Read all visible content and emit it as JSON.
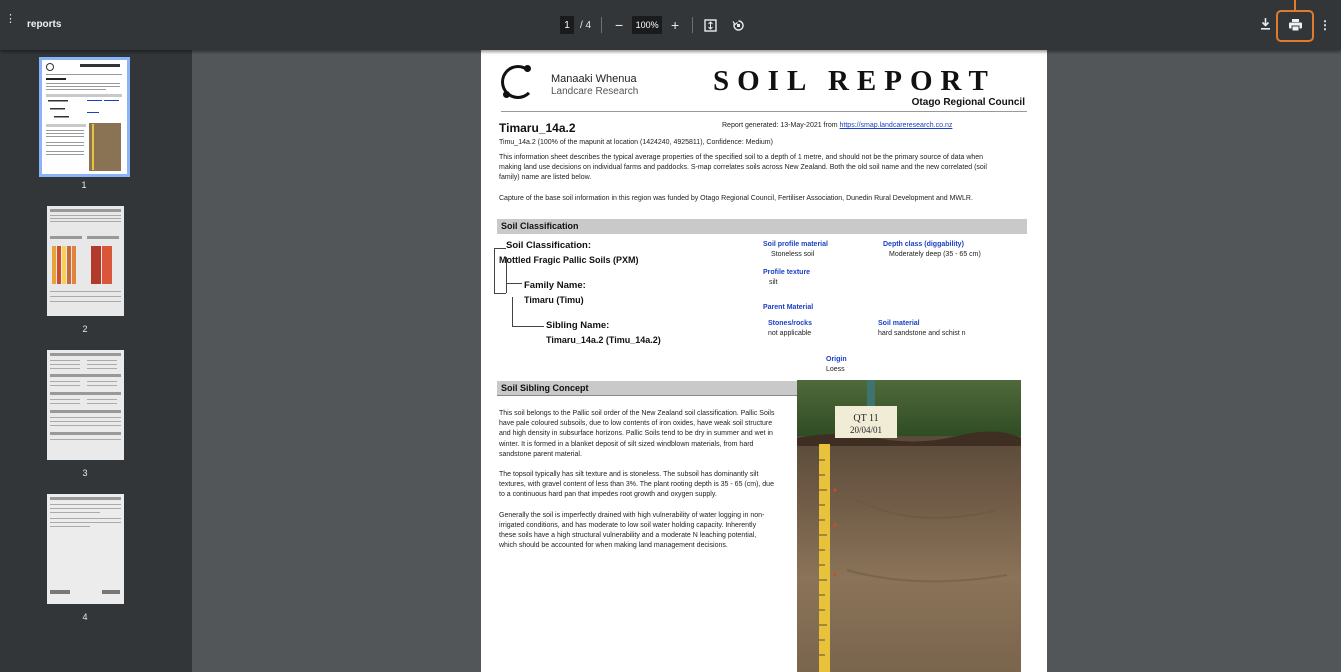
{
  "toolbar": {
    "title": "reports",
    "page_current": "1",
    "page_total": "/ 4",
    "zoom": "100%",
    "zoom_out": "−",
    "zoom_in": "+"
  },
  "thumbnails": [
    {
      "label": "1"
    },
    {
      "label": "2"
    },
    {
      "label": "3"
    },
    {
      "label": "4"
    }
  ],
  "report": {
    "org_name": "Manaaki Whenua",
    "org_sub": "Landcare Research",
    "title": "SOIL  REPORT",
    "council": "Otago Regional Council",
    "soil_name": "Timaru_14a.2",
    "generated_prefix": "Report generated: 13-May-2021 from ",
    "generated_link": "https://smap.landcareresearch.co.nz",
    "subtitle": "Timu_14a.2 (100% of the mapunit at location (1424240, 4925811), Confidence: Medium)",
    "intro": "This information sheet describes the typical average properties of the specified soil to a depth of 1 metre, and should not be the primary source of data when making land use decisions on individual farms and paddocks. S-map correlates soils across New Zealand. Both the old soil name and the new correlated (soil family) name are listed below.",
    "funding": "Capture of the base soil information in this region was funded by Otago Regional Council, Fertiliser Association, Dunedin Rural Development and MWLR.",
    "classification_header": "Soil Classification",
    "class_label": "Soil Classification:",
    "class_value": "Mottled Fragic Pallic Soils (PXM)",
    "family_label": "Family Name:",
    "family_value": "Timaru (Timu)",
    "sibling_label": "Sibling Name:",
    "sibling_value": "Timaru_14a.2 (Timu_14a.2)",
    "profile_material_h": "Soil profile material",
    "profile_material_v": "Stoneless soil",
    "depth_class_h": "Depth class (diggability)",
    "depth_class_v": "Moderately deep (35 - 65 cm)",
    "profile_texture_h": "Profile texture",
    "profile_texture_v": "silt",
    "parent_material_h": "Parent Material",
    "stones_h": "Stones/rocks",
    "stones_v": "not applicable",
    "soil_material_h": "Soil material",
    "soil_material_v": "hard sandstone and schist n",
    "origin_h": "Origin",
    "origin_v": "Loess",
    "sibling_concept_header": "Soil Sibling Concept",
    "concept_p1": "This soil belongs to the Pallic soil order of the New Zealand soil classification. Pallic Soils have pale coloured subsoils, due to low contents of iron oxides, have weak soil structure and high density in subsurface horizons. Pallic Soils tend to be dry in summer and wet in winter. It is formed in a blanket deposit of silt sized windblown materials, from hard sandstone parent material.",
    "concept_p2": "The topsoil typically has silt texture and is stoneless. The subsoil has dominantly silt textures, with gravel content of less than 3%. The plant rooting depth is 35 - 65 (cm), due to a continuous hard pan that impedes root growth and oxygen supply.",
    "concept_p3": "Generally the soil is imperfectly drained with high vulnerability of water logging in non-irrigated conditions, and has moderate to low soil water holding capacity. Inherently these soils have a high structural vulnerability and a moderate N leaching potential, which should be accounted for when making land management decisions.",
    "photo_sign_line1": "QT 11",
    "photo_sign_line2": "20/04/01"
  },
  "colors": {
    "toolbar_bg": "#323639",
    "viewer_bg": "#525659",
    "highlight": "#e07b2c",
    "link": "#1a3fc4"
  }
}
